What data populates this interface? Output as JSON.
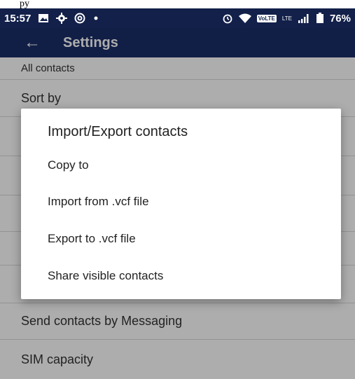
{
  "caption": "py",
  "status_bar": {
    "time": "15:57",
    "icons_left": [
      "image-icon",
      "gear-icon",
      "at-icon",
      "dot-icon"
    ],
    "icons_right": [
      "alarm-icon",
      "wifi-icon",
      "volte-icon",
      "signal-icon",
      "battery-icon"
    ],
    "volte": "VoLTE",
    "lte": "LTE",
    "battery": "76%"
  },
  "app_bar": {
    "back_icon": "arrow-left-icon",
    "title": "Settings"
  },
  "settings_list": [
    "All contacts",
    "Sort by",
    "Send contacts by Messaging",
    "SIM capacity"
  ],
  "dialog": {
    "title": "Import/Export contacts",
    "items": [
      "Copy to",
      "Import from .vcf file",
      "Export to .vcf file",
      "Share visible contacts"
    ]
  },
  "colors": {
    "status_bar": "#12204a",
    "app_bar": "#1a2d68"
  }
}
